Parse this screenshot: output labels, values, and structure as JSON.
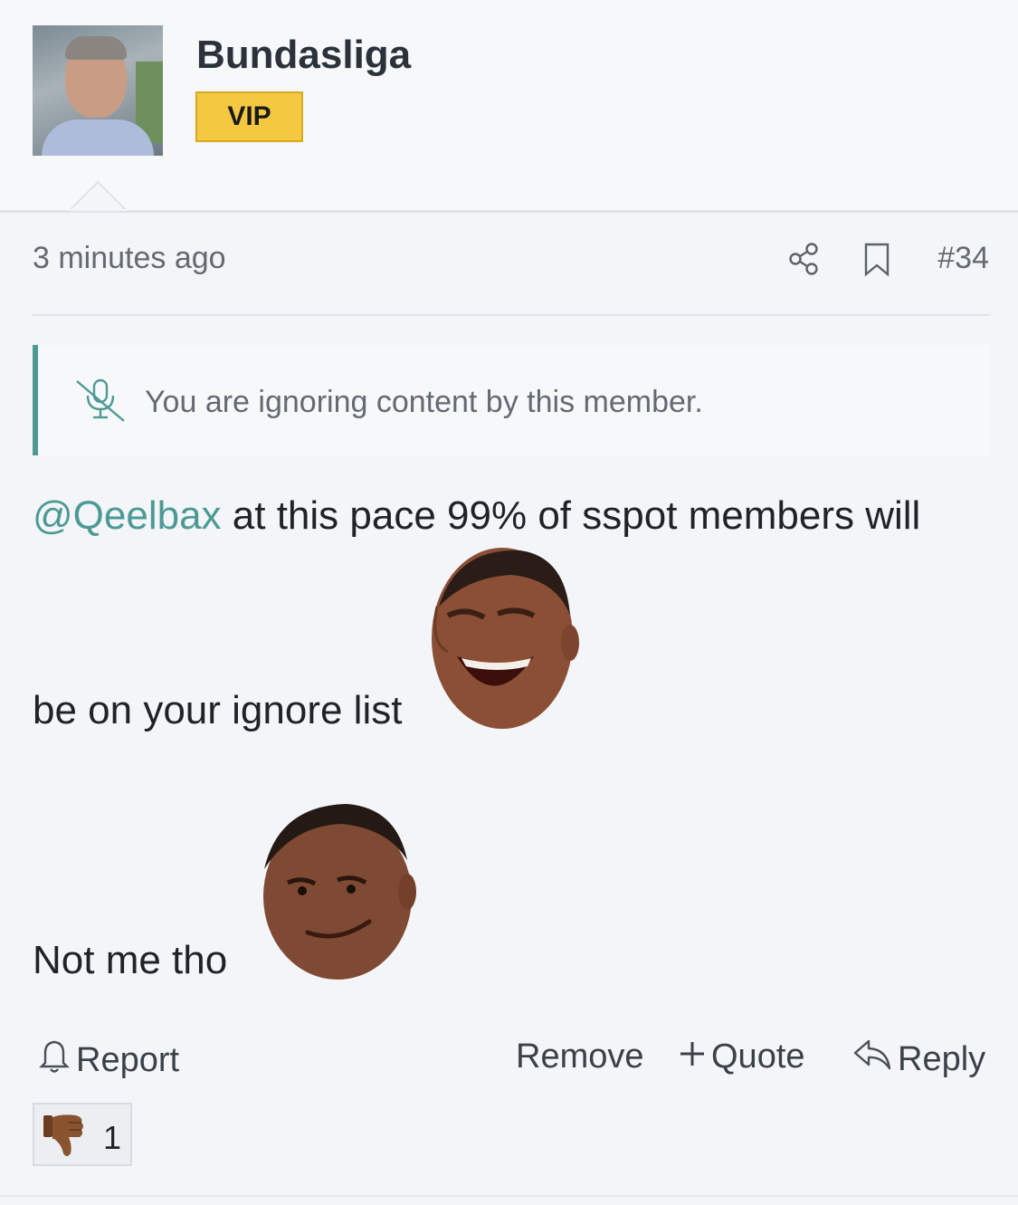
{
  "post": {
    "username": "Bundasliga",
    "badge": "VIP",
    "time_ago": "3 minutes ago",
    "post_number": "#34",
    "ignored_notice": "You are ignoring content by this member.",
    "mention": "@Qeelbax",
    "line1_rest": " at this pace 99% of sspot members will",
    "line2": "be on your ignore list",
    "line3": "Not me tho"
  },
  "actions": {
    "report": "Report",
    "remove": "Remove",
    "quote": "Quote",
    "reply": "Reply"
  },
  "reaction": {
    "icon": "thumbs-down-icon",
    "count": "1"
  },
  "icons": {
    "share": "share-icon",
    "bookmark": "bookmark-icon",
    "mute": "muted-microphone-icon",
    "bell": "bell-icon",
    "plus": "plus-icon",
    "reply": "reply-arrow-icon"
  },
  "colors": {
    "accent": "#4d9a95",
    "badge_bg": "#f5c842",
    "page_bg": "#f3f5f9"
  }
}
